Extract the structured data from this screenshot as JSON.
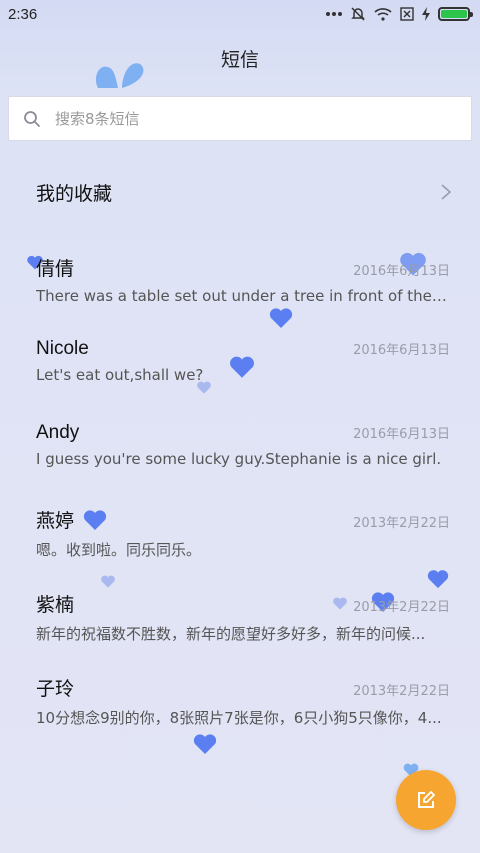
{
  "status_bar": {
    "time": "2:36",
    "icons": [
      "more-dots-icon",
      "mute-bell-icon",
      "wifi-icon",
      "no-sim-icon",
      "charging-icon",
      "battery-icon"
    ],
    "battery_color": "#2cc44a"
  },
  "header": {
    "title": "短信"
  },
  "search": {
    "placeholder": "搜索8条短信"
  },
  "favorites": {
    "label": "我的收藏"
  },
  "messages": [
    {
      "name": "倩倩",
      "date": "2016年6月13日",
      "preview": "There was a table set out under a tree in front of the ho..."
    },
    {
      "name": "Nicole",
      "date": "2016年6月13日",
      "preview": "Let's eat out,shall we?"
    },
    {
      "name": "Andy",
      "date": "2016年6月13日",
      "preview": "I guess you're some lucky guy.Stephanie is a nice girl."
    },
    {
      "name": "燕婷",
      "date": "2013年2月22日",
      "preview": "嗯。收到啦。同乐同乐。"
    },
    {
      "name": "紫楠",
      "date": "2013年2月22日",
      "preview": "新年的祝福数不胜数，新年的愿望好多好多，新年的问候..."
    },
    {
      "name": "子玲",
      "date": "2013年2月22日",
      "preview": "10分想念9别的你，8张照片7张是你，6只小狗5只像你，4..."
    }
  ],
  "fab": {
    "icon": "compose-icon",
    "color": "#f5a530"
  },
  "colors": {
    "accent": "#f5a530",
    "heart": "#5b7ff0",
    "background": "#dfe3f4"
  }
}
